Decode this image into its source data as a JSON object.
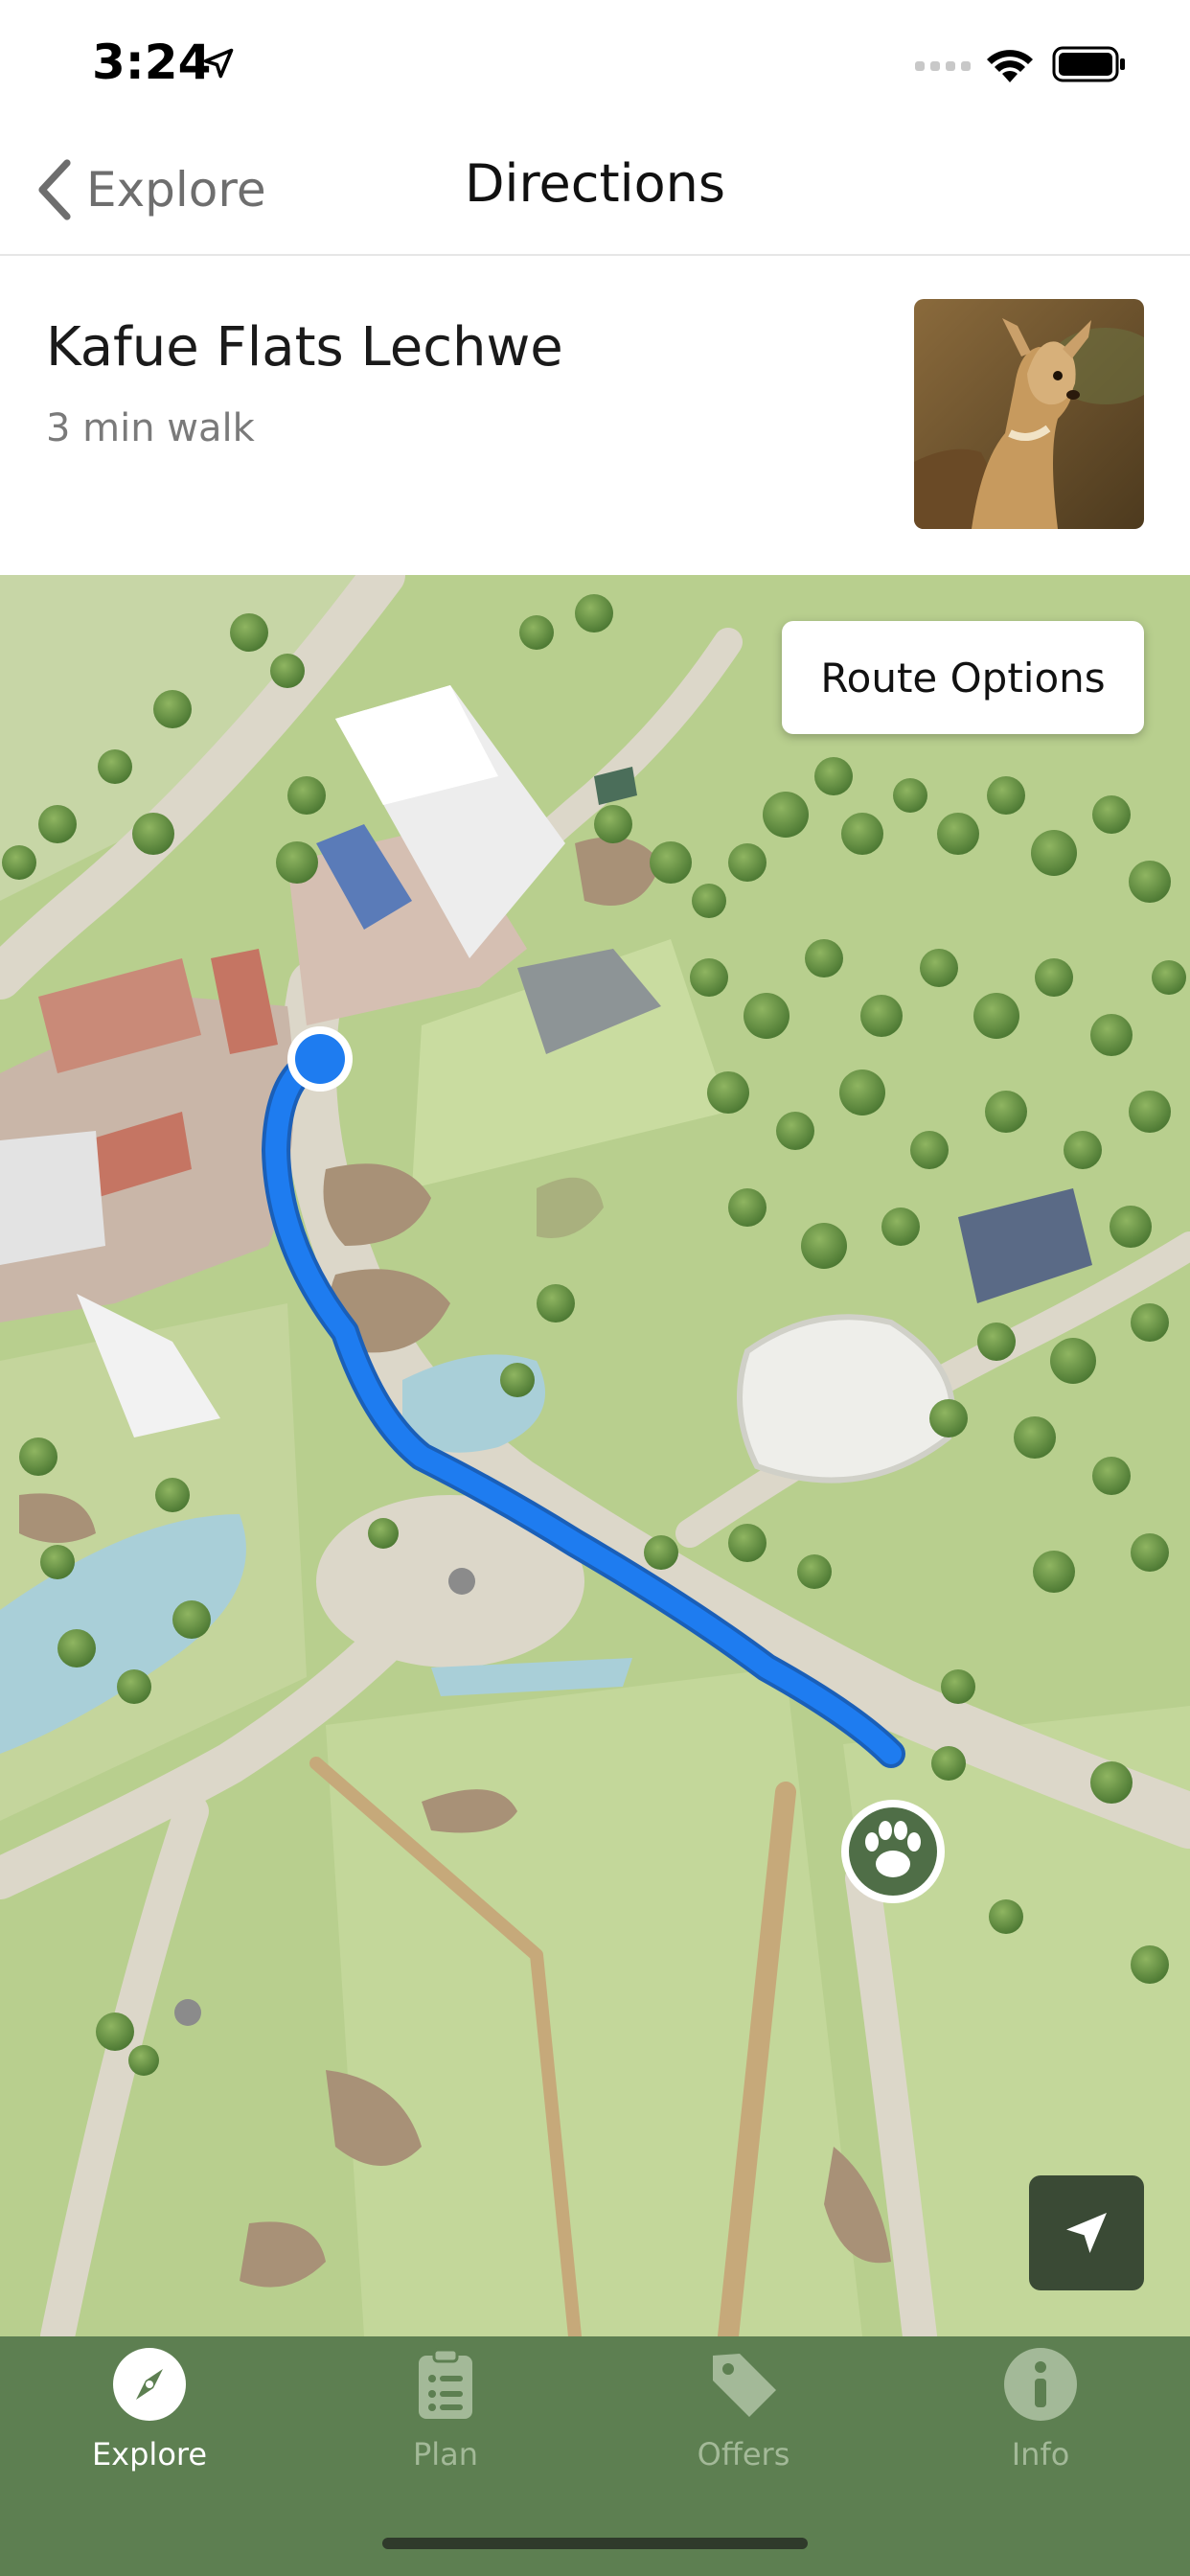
{
  "status_bar": {
    "time": "3:24"
  },
  "nav": {
    "back_label": "Explore",
    "title": "Directions"
  },
  "destination": {
    "name": "Kafue Flats Lechwe",
    "walk_time": "3 min walk"
  },
  "map": {
    "route_options_label": "Route Options",
    "route_color": "#1e7cf0",
    "user_dot_color": "#1e7cf0",
    "marker_color": "#4f6e47"
  },
  "icons": [
    "location-arrow-icon",
    "signal-icon",
    "wifi-icon",
    "battery-icon",
    "chevron-left-icon",
    "paw-icon",
    "navigation-arrow-icon",
    "compass-icon",
    "clipboard-list-icon",
    "tag-icon",
    "info-icon"
  ],
  "tabs": [
    {
      "label": "Explore",
      "icon": "compass-icon",
      "active": true
    },
    {
      "label": "Plan",
      "icon": "clipboard-list-icon",
      "active": false
    },
    {
      "label": "Offers",
      "icon": "tag-icon",
      "active": false
    },
    {
      "label": "Info",
      "icon": "info-icon",
      "active": false
    }
  ],
  "colors": {
    "tab_bar_bg": "#5d7f51",
    "tab_active": "#ffffff",
    "tab_inactive": "#a3b998"
  }
}
